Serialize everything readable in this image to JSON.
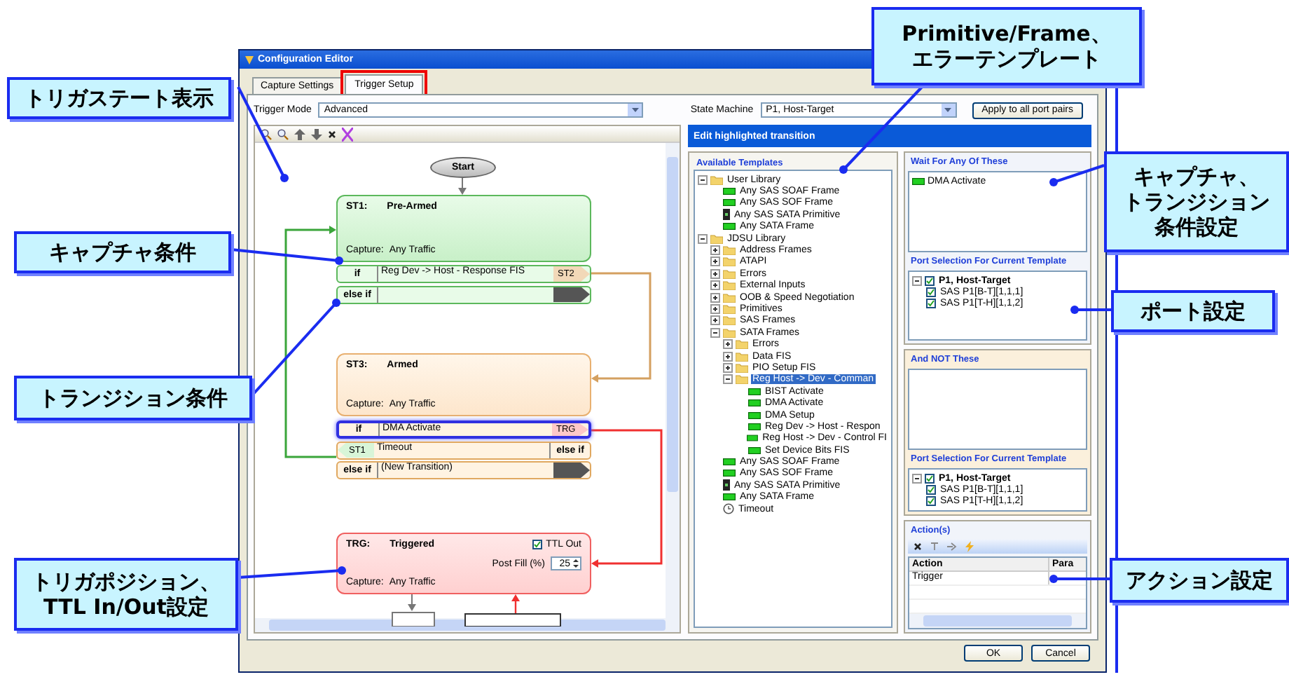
{
  "window": {
    "title": "Configuration Editor"
  },
  "tabs": [
    {
      "label": "Capture Settings",
      "selected": false,
      "marked": false
    },
    {
      "label": "Trigger Setup",
      "selected": true,
      "marked": true
    }
  ],
  "trigger_mode": {
    "label": "Trigger Mode",
    "value": "Advanced"
  },
  "state_machine": {
    "label": "State Machine",
    "value": "P1, Host-Target"
  },
  "apply_button": "Apply to all port pairs",
  "flowchart": {
    "start": "Start",
    "states": [
      {
        "kind": "normal",
        "id": "ST1:",
        "name": "Pre-Armed",
        "capture_label": "Capture:",
        "capture": "Any Traffic",
        "transitions": [
          {
            "kind": "forward",
            "keyword": "if",
            "condition": "Reg Dev -> Host - Response FIS",
            "target": "ST2",
            "highlighted": false
          },
          {
            "kind": "forward",
            "keyword": "else if",
            "highlighted": false
          }
        ]
      },
      {
        "kind": "armed",
        "id": "ST3:",
        "name": "Armed",
        "capture_label": "Capture:",
        "capture": "Any Traffic",
        "transitions": [
          {
            "kind": "forward",
            "keyword": "if",
            "condition": "DMA Activate",
            "target": "TRG",
            "highlighted": true
          },
          {
            "kind": "back",
            "keyword": "else if",
            "condition": "Timeout",
            "target": "ST1",
            "highlighted": false
          },
          {
            "kind": "forward",
            "keyword": "else if",
            "condition": "(New Transition)",
            "highlighted": false
          }
        ]
      },
      {
        "kind": "trigger",
        "id": "TRG:",
        "name": "Triggered",
        "capture_label": "Capture:",
        "capture": "Any Traffic",
        "ttl": {
          "label": "TTL Out",
          "checked": true
        },
        "post_fill": {
          "label": "Post Fill (%)",
          "value": "25"
        }
      }
    ]
  },
  "transition_header": "Edit highlighted transition",
  "templates": {
    "title": "Available Templates",
    "tree": [
      {
        "kind": "folder",
        "label": "User Library",
        "expanded": true,
        "selected": false,
        "children": [
          {
            "kind": "frame",
            "label": "Any SAS SOAF Frame",
            "selected": false
          },
          {
            "kind": "frame",
            "label": "Any SAS SOF Frame",
            "selected": false
          },
          {
            "kind": "primitive",
            "label": "Any SAS SATA Primitive",
            "selected": false
          },
          {
            "kind": "frame",
            "label": "Any SATA Frame",
            "selected": false
          }
        ]
      },
      {
        "kind": "folder",
        "label": "JDSU Library",
        "expanded": true,
        "selected": false,
        "children": [
          {
            "kind": "folder",
            "label": "Address Frames",
            "expanded": false,
            "selected": false
          },
          {
            "kind": "folder",
            "label": "ATAPI",
            "expanded": false,
            "selected": false
          },
          {
            "kind": "folder",
            "label": "Errors",
            "expanded": false,
            "selected": false
          },
          {
            "kind": "folder",
            "label": "External Inputs",
            "expanded": false,
            "selected": false
          },
          {
            "kind": "folder",
            "label": "OOB & Speed Negotiation",
            "expanded": false,
            "selected": false
          },
          {
            "kind": "folder",
            "label": "Primitives",
            "expanded": false,
            "selected": false
          },
          {
            "kind": "folder",
            "label": "SAS Frames",
            "expanded": false,
            "selected": false
          },
          {
            "kind": "folder",
            "label": "SATA Frames",
            "expanded": true,
            "selected": false,
            "children": [
              {
                "kind": "folder",
                "label": "Errors",
                "expanded": false,
                "selected": false
              },
              {
                "kind": "folder",
                "label": "Data FIS",
                "expanded": false,
                "selected": false
              },
              {
                "kind": "folder",
                "label": "PIO Setup FIS",
                "expanded": false,
                "selected": false
              },
              {
                "kind": "folder",
                "label": "Reg Host -> Dev - Comman",
                "expanded": true,
                "selected": true,
                "children": [
                  {
                    "kind": "frame",
                    "label": "BIST Activate",
                    "selected": false
                  },
                  {
                    "kind": "frame",
                    "label": "DMA Activate",
                    "selected": false
                  },
                  {
                    "kind": "frame",
                    "label": "DMA Setup",
                    "selected": false
                  },
                  {
                    "kind": "frame",
                    "label": "Reg Dev -> Host - Respon",
                    "selected": false
                  },
                  {
                    "kind": "frame",
                    "label": "Reg Host -> Dev - Control FI",
                    "selected": false
                  },
                  {
                    "kind": "frame",
                    "label": "Set Device Bits FIS",
                    "selected": false
                  }
                ]
              }
            ]
          },
          {
            "kind": "frame",
            "label": "Any SAS SOAF Frame",
            "selected": false
          },
          {
            "kind": "frame",
            "label": "Any SAS SOF Frame",
            "selected": false
          },
          {
            "kind": "primitive",
            "label": "Any SAS SATA Primitive",
            "selected": false
          },
          {
            "kind": "frame",
            "label": "Any SATA Frame",
            "selected": false
          },
          {
            "kind": "timeout",
            "label": "Timeout",
            "selected": false
          }
        ]
      }
    ]
  },
  "wait_for": {
    "title": "Wait For Any Of These",
    "items": [
      {
        "kind": "frame",
        "label": "DMA Activate"
      }
    ],
    "port_title": "Port Selection For Current Template",
    "ports": [
      {
        "label": "P1, Host-Target",
        "checked": true,
        "expanded": true,
        "children": [
          {
            "label": "SAS P1[B-T][1,1,1]",
            "checked": true
          },
          {
            "label": "SAS P1[T-H][1,1,2]",
            "checked": true
          }
        ]
      }
    ]
  },
  "and_not": {
    "title": "And NOT These",
    "port_title": "Port Selection For Current Template",
    "ports": [
      {
        "label": "P1, Host-Target",
        "checked": true,
        "expanded": true,
        "children": [
          {
            "label": "SAS P1[B-T][1,1,1]",
            "checked": true
          },
          {
            "label": "SAS P1[T-H][1,1,2]",
            "checked": true
          }
        ]
      }
    ]
  },
  "actions": {
    "title": "Action(s)",
    "columns": [
      "Action",
      "Para"
    ],
    "rows": [
      [
        "Trigger"
      ]
    ]
  },
  "buttons": [
    "OK",
    "Cancel"
  ],
  "callouts": [
    {
      "lines": [
        "トリガステート表示"
      ]
    },
    {
      "lines": [
        "キャプチャ条件"
      ]
    },
    {
      "lines": [
        "トランジション条件"
      ]
    },
    {
      "lines": [
        "トリガポジション、",
        "TTL In/Out設定"
      ]
    },
    {
      "lines": [
        "Primitive/Frame、",
        "エラーテンプレート"
      ]
    },
    {
      "lines": [
        "キャプチャ、",
        "トランジション",
        "条件設定"
      ]
    },
    {
      "lines": [
        "ポート設定"
      ]
    },
    {
      "lines": [
        "アクション設定"
      ]
    }
  ]
}
